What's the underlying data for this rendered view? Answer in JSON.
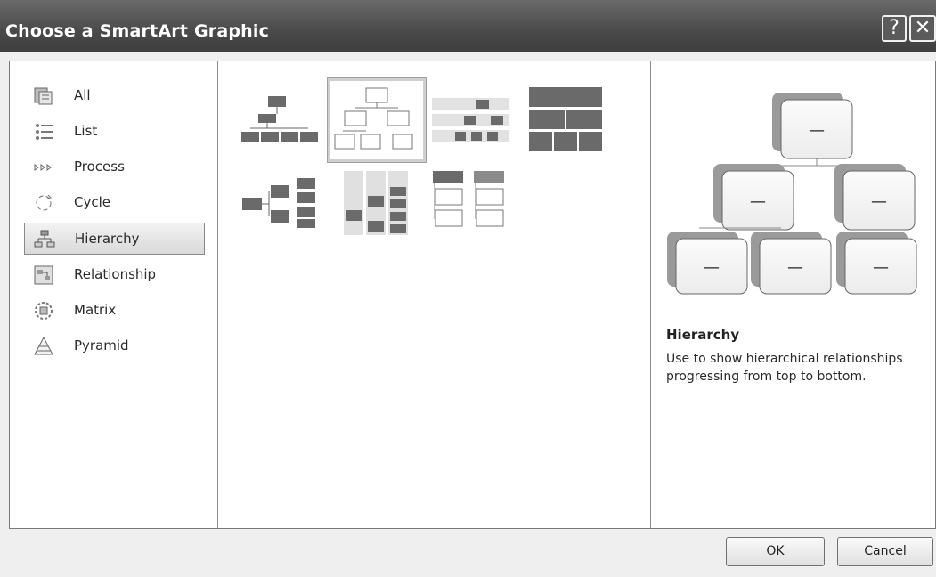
{
  "dialog": {
    "title": "Choose a SmartArt Graphic",
    "help_label": "?",
    "close_label": "✕"
  },
  "categories": [
    {
      "label": "All",
      "icon": "all-icon"
    },
    {
      "label": "List",
      "icon": "list-icon"
    },
    {
      "label": "Process",
      "icon": "process-icon"
    },
    {
      "label": "Cycle",
      "icon": "cycle-icon"
    },
    {
      "label": "Hierarchy",
      "icon": "hierarchy-icon",
      "selected": true
    },
    {
      "label": "Relationship",
      "icon": "relationship-icon"
    },
    {
      "label": "Matrix",
      "icon": "matrix-icon"
    },
    {
      "label": "Pyramid",
      "icon": "pyramid-icon"
    }
  ],
  "preview": {
    "title": "Hierarchy",
    "description": "Use to show hierarchical relationships progressing from top to bottom.",
    "box_dash": "—"
  },
  "buttons": {
    "ok": "OK",
    "cancel": "Cancel"
  },
  "colors": {
    "titlebar": "#4a4a4a",
    "selection": "#d9d9d9",
    "shape_dark": "#6e6e6e"
  }
}
